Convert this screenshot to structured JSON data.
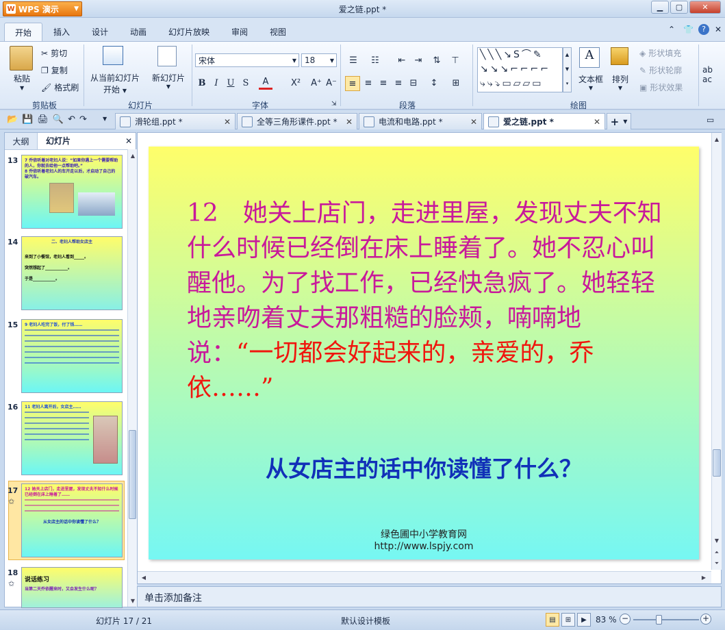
{
  "app": {
    "name": "WPS 演示",
    "doc_title": "爱之链.ppt *"
  },
  "menu": [
    "开始",
    "插入",
    "设计",
    "动画",
    "幻灯片放映",
    "审阅",
    "视图"
  ],
  "ribbon": {
    "clipboard": {
      "paste": "粘贴",
      "cut": "剪切",
      "copy": "复制",
      "format_painter": "格式刷",
      "label": "剪贴板"
    },
    "slides": {
      "from_current": "从当前幻灯片",
      "start": "开始",
      "new_slide": "新幻灯片",
      "label": "幻灯片"
    },
    "font": {
      "name": "宋体",
      "size": "18",
      "label": "字体"
    },
    "paragraph": {
      "label": "段落"
    },
    "drawing": {
      "textbox": "文本框",
      "arrange": "排列",
      "shape_fill": "形状填充",
      "shape_outline": "形状轮廓",
      "shape_effect": "形状效果",
      "label": "绘图"
    }
  },
  "tabs": [
    {
      "label": "滑轮组.ppt *"
    },
    {
      "label": "全等三角形课件.ppt *"
    },
    {
      "label": "电流和电路.ppt *"
    },
    {
      "label": "爱之链.ppt *"
    }
  ],
  "panel": {
    "outline_tab": "大纲",
    "slides_tab": "幻灯片"
  },
  "thumbnails": [
    {
      "num": "13",
      "line1": "7  乔依听着对老妇人说：“如果你遇上一个需要帮助的人，你就去给他一点帮助吧。”",
      "line2": "8  乔依听着老妇人的车开走以后，才启动了自己的破汽车。"
    },
    {
      "num": "14",
      "title": "二、老妇人帮助女店主",
      "l1": "来到了小餐馆，老妇人看到_____。",
      "l2": "突然想起了___________。",
      "l3": "于是___________。"
    },
    {
      "num": "15",
      "text": "9  老妇人吃完了饭，付了钱……"
    },
    {
      "num": "16",
      "text": "11  老妇人离开后，女店主……"
    },
    {
      "num": "17",
      "text": "12  她关上店门，走进里屋，发现丈夫不知什么时候已经倒在床上睡着了……",
      "q": "从女店主的话中你读懂了什么？"
    },
    {
      "num": "18",
      "title": "说话练习",
      "text": "当第二天乔依醒来时，又会发生什么呢？"
    }
  ],
  "slide": {
    "body_normal": "12　她关上店门，走进里屋，发现丈夫不知什么时候已经倒在床上睡着了。她不忍心叫醒他。为了找工作，已经快急疯了。她轻轻地亲吻着丈夫那粗糙的脸颊，喃喃地说：",
    "body_red": "“一切都会好起来的，亲爱的，乔依……”",
    "question": "从女店主的话中你读懂了什么？",
    "footer_site": "绿色圃中小学教育网",
    "footer_url": "http://www.lspjy.com"
  },
  "notes_placeholder": "单击添加备注",
  "status": {
    "slide_counter": "幻灯片 17 / 21",
    "template": "默认设计模板",
    "zoom": "83 %"
  },
  "colors": {
    "accent": "#e8760e",
    "slide_top": "#fffe6a",
    "slide_bottom": "#76f7f3",
    "body_text": "#c8199b",
    "quote_text": "#f0160e",
    "question_text": "#1130b8"
  }
}
